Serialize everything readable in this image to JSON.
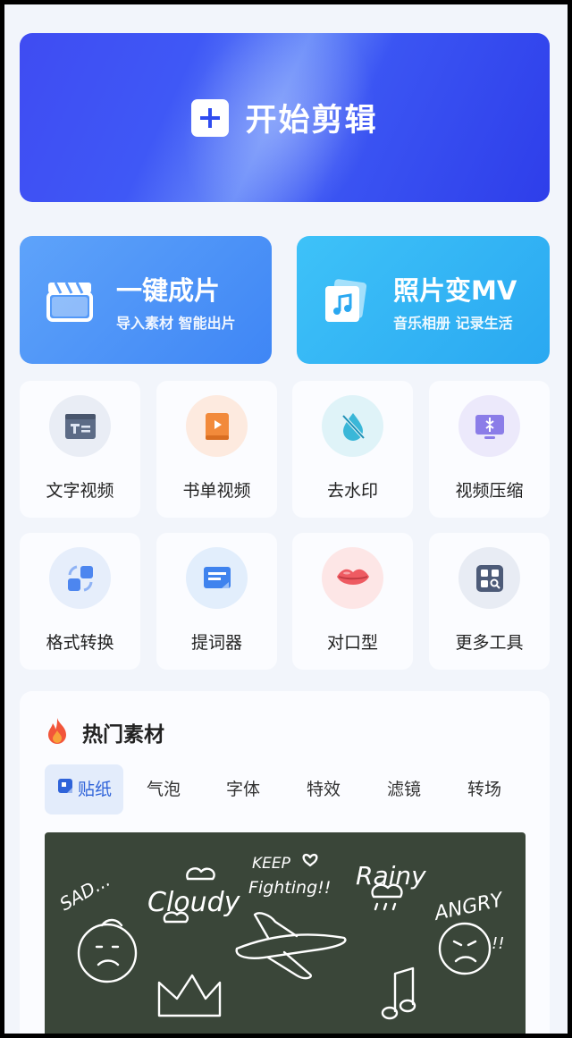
{
  "start_banner": {
    "label": "开始剪辑"
  },
  "features": [
    {
      "title": "一键成片",
      "subtitle": "导入素材 智能出片",
      "icon": "clapperboard-icon"
    },
    {
      "title": "照片变MV",
      "subtitle": "音乐相册 记录生活",
      "icon": "photo-music-icon"
    }
  ],
  "tools": [
    {
      "label": "文字视频",
      "icon": "text-video-icon"
    },
    {
      "label": "书单视频",
      "icon": "book-video-icon"
    },
    {
      "label": "去水印",
      "icon": "watermark-remove-icon"
    },
    {
      "label": "视频压缩",
      "icon": "video-compress-icon"
    },
    {
      "label": "格式转换",
      "icon": "format-convert-icon"
    },
    {
      "label": "提词器",
      "icon": "teleprompter-icon"
    },
    {
      "label": "对口型",
      "icon": "lip-sync-icon"
    },
    {
      "label": "更多工具",
      "icon": "more-tools-icon"
    }
  ],
  "hot_materials": {
    "title": "热门素材",
    "icon": "flame-icon",
    "tabs": [
      "贴纸",
      "气泡",
      "字体",
      "特效",
      "滤镜",
      "转场"
    ],
    "active_tab": 0
  },
  "sticker_preview": {
    "words": [
      "SAD...",
      "Cloudy",
      "KEEP",
      "Fighting!!",
      "Rainy",
      "ANGRY",
      "!!"
    ]
  },
  "colors": {
    "banner": "#3f52f4",
    "card_blue": "#4b93f7",
    "card_cyan": "#33b5f4",
    "tab_active": "#2f63d9",
    "board": "#3a4639"
  }
}
